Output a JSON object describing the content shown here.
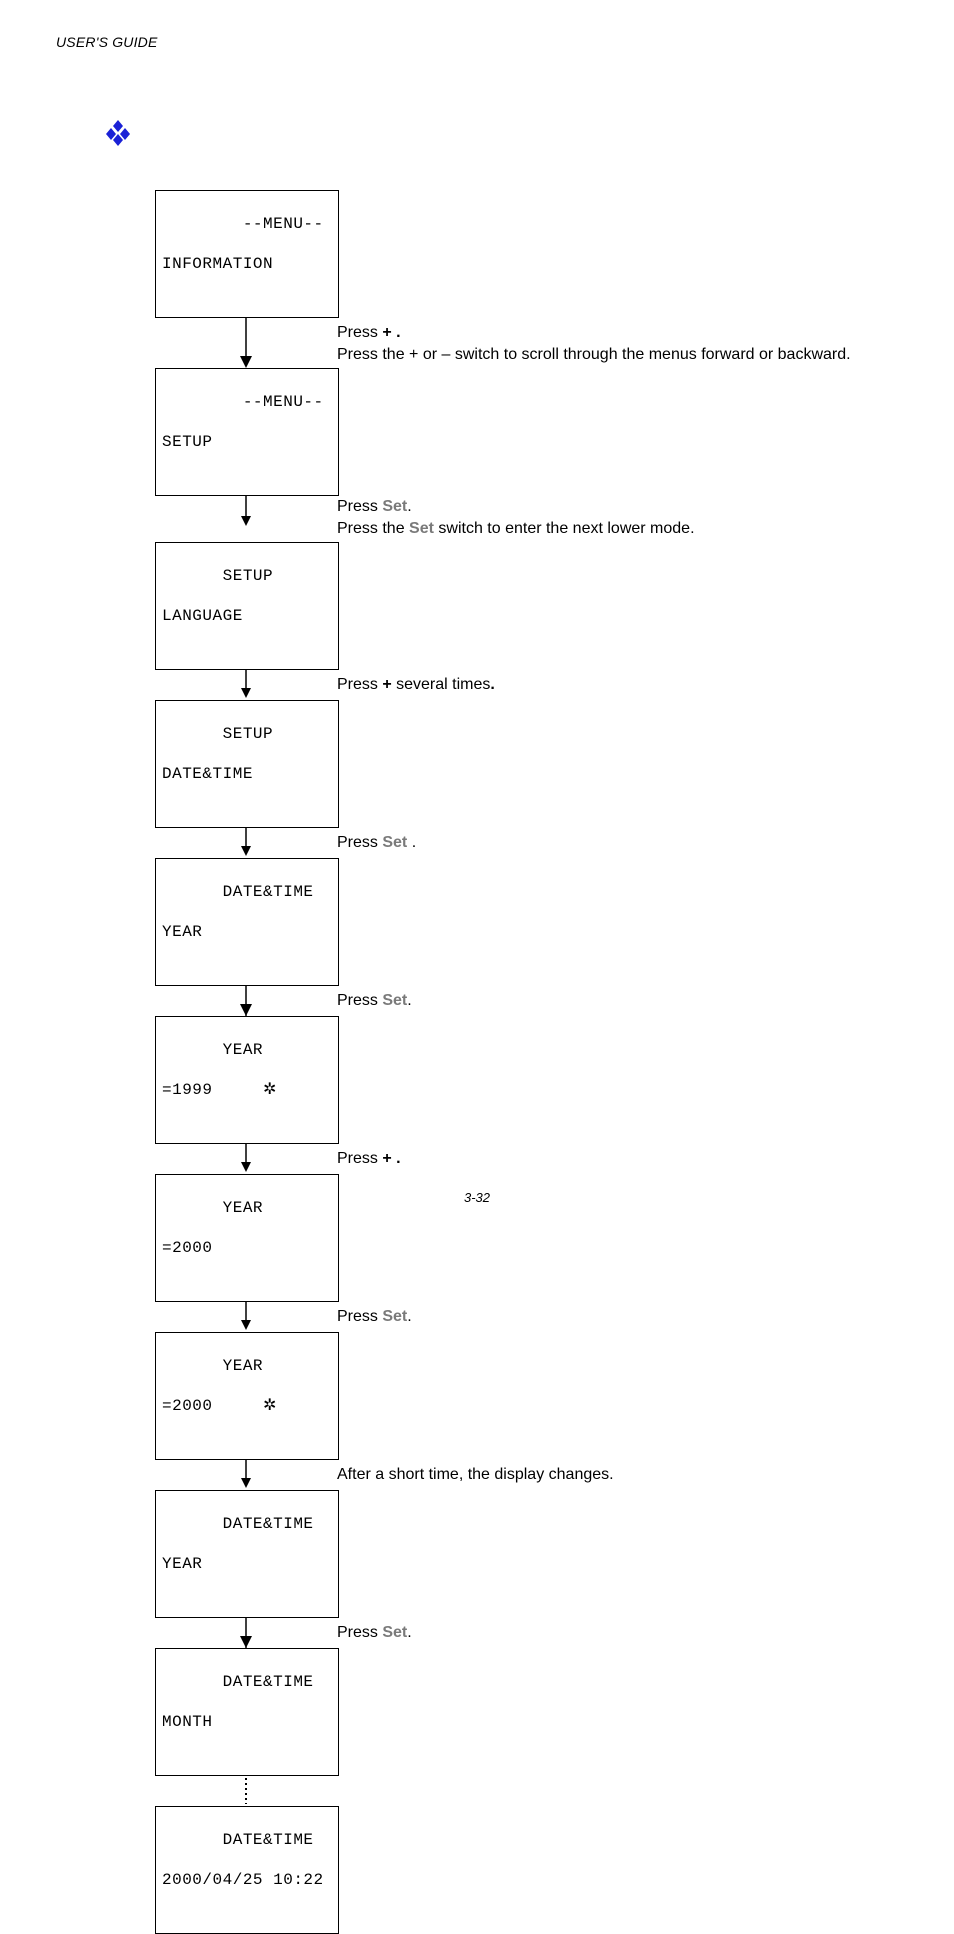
{
  "header": "USER'S GUIDE",
  "pagenum": "3-32",
  "boxes": {
    "b0": {
      "l1": "  --MENU--",
      "l2": "INFORMATION"
    },
    "b1": {
      "l1": "  --MENU--",
      "l2": "SETUP"
    },
    "b2": {
      "l1": "SETUP",
      "l2": "LANGUAGE"
    },
    "b3": {
      "l1": "SETUP",
      "l2": "DATE&TIME"
    },
    "b4": {
      "l1": "DATE&TIME",
      "l2": "YEAR"
    },
    "b5": {
      "l1": "YEAR",
      "l2": "=1999     ✲"
    },
    "b6": {
      "l1": "YEAR",
      "l2": "=2000"
    },
    "b7": {
      "l1": "YEAR",
      "l2": "=2000     ✲"
    },
    "b8": {
      "l1": "DATE&TIME",
      "l2": "YEAR"
    },
    "b9": {
      "l1": "DATE&TIME",
      "l2": "MONTH"
    },
    "b10": {
      "l1": "DATE&TIME",
      "l2": "2000/04/25 10:22"
    }
  },
  "instr": {
    "i0a": "Press ",
    "i0b": " + .",
    "i0c": "Press the ",
    "i0d": "+",
    "i0e": " or ",
    "i0f": "–",
    "i0g": " switch to scroll through the menus forward or backward.",
    "i1a": "Press ",
    "i1b": "Set",
    "i1c": ".",
    "i1d": "Press the ",
    "i1e": "Set",
    "i1f": " switch to enter the next lower mode.",
    "i2a": "Press ",
    "i2b": " +",
    "i2c": " several times",
    "i2d": ".",
    "i3a": "Press ",
    "i3b": " Set ",
    "i3c": ".",
    "i4a": "Press ",
    "i4b": "Set",
    "i4c": ".",
    "i5a": "Press ",
    "i5b": " + .",
    "i6a": "Press ",
    "i6b": "Set",
    "i6c": ".",
    "i7": "After a short time, the display changes.",
    "i8a": "Press ",
    "i8b": "Set",
    "i8c": "."
  }
}
